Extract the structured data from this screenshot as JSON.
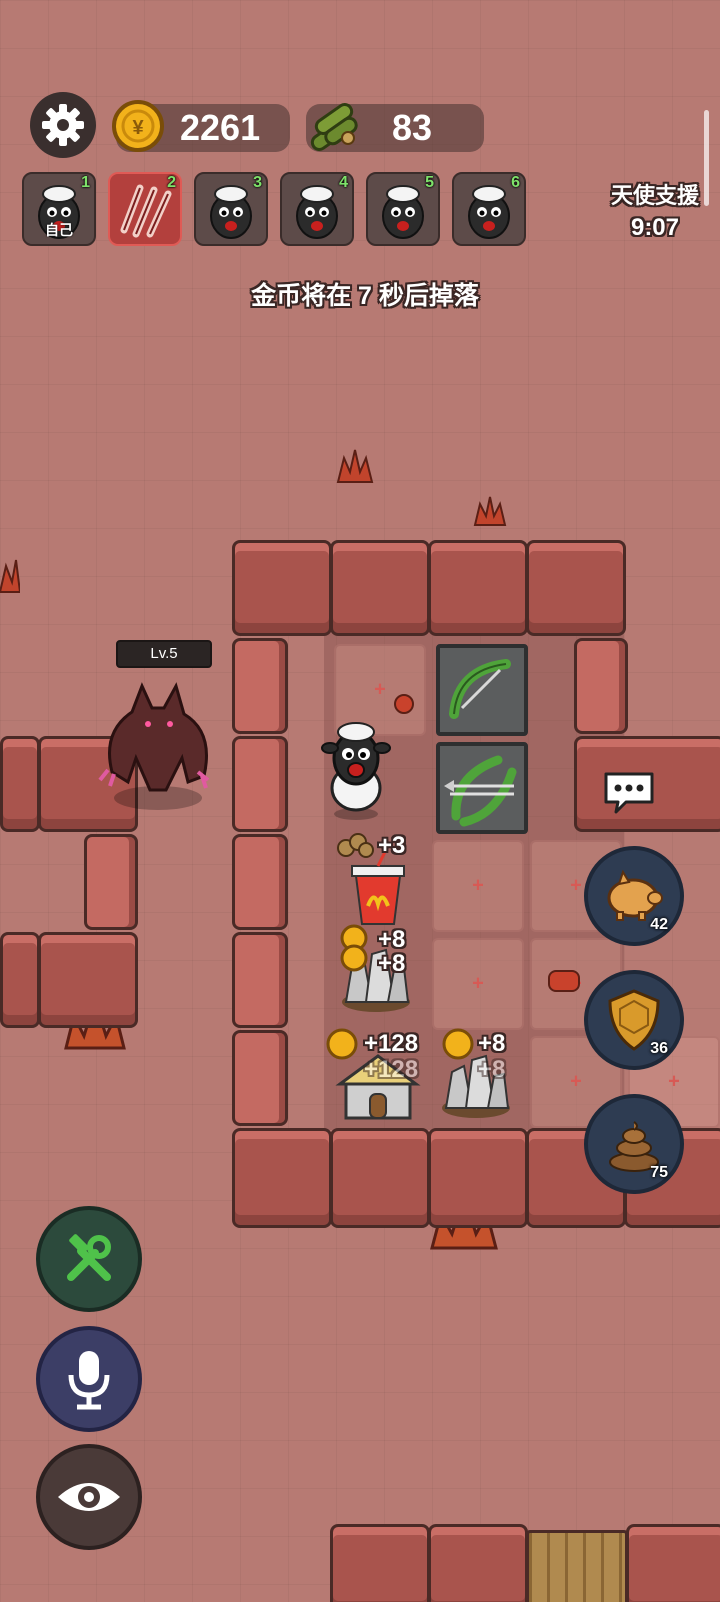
{
  "hud": {
    "settings_icon": "gear-icon",
    "gold_value": "2261",
    "wood_value": "83",
    "gold_icon": "coin-icon",
    "wood_icon": "log-bundle-icon"
  },
  "players": [
    {
      "num": "1",
      "label": "自己",
      "icon": "sheep-avatar-icon"
    },
    {
      "num": "2",
      "label": "",
      "icon": "werewolf-claw-avatar-icon"
    },
    {
      "num": "3",
      "label": "",
      "icon": "sheep-avatar-icon"
    },
    {
      "num": "4",
      "label": "",
      "icon": "sheep-avatar-icon"
    },
    {
      "num": "5",
      "label": "",
      "icon": "sheep-avatar-icon"
    },
    {
      "num": "6",
      "label": "",
      "icon": "sheep-avatar-icon"
    }
  ],
  "support": {
    "title": "天使支援",
    "timer": "9:07"
  },
  "notice": "金币将在 7 秒后掉落",
  "enemy": {
    "level": "Lv.5",
    "icon": "werewolf-icon"
  },
  "buildings": {
    "drink_income": "+3",
    "rock_income_1": "+8",
    "rock_income_1b": "+8",
    "house_income": "+128",
    "house_income_shadow": "+128",
    "rock_income_2": "+8",
    "rock_income_2_shadow": "+8"
  },
  "side_buttons": [
    {
      "name": "piggy-bank",
      "icon": "piggy-bank-icon",
      "count": "42"
    },
    {
      "name": "shield",
      "icon": "shield-icon",
      "count": "36"
    },
    {
      "name": "poop",
      "icon": "poop-icon",
      "count": "75"
    }
  ],
  "bottom_buttons": [
    {
      "name": "build",
      "icon": "wrench-hammer-icon"
    },
    {
      "name": "microphone",
      "icon": "microphone-icon"
    },
    {
      "name": "view",
      "icon": "eye-icon"
    }
  ],
  "chat_icon": "speech-bubble-icon",
  "colors": {
    "gold": "#f2b21b",
    "wood": "#6c8a2e",
    "active_player": "#b3403d",
    "income_text": "#ffffff"
  }
}
